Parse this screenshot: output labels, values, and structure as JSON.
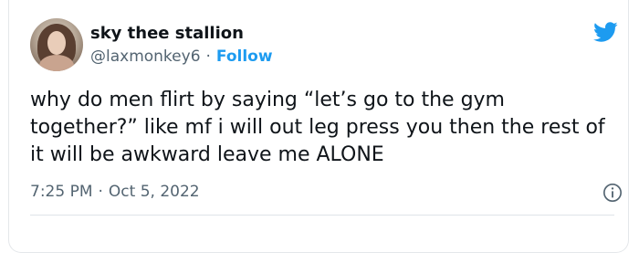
{
  "tweet": {
    "display_name": "sky thee stallion",
    "handle": "@laxmonkey6",
    "separator": "·",
    "follow_label": "Follow",
    "text": "why do men flirt by saying “let’s go to the gym together?” like mf i will out leg press you then the rest of it will be awkward leave me ALONE",
    "time": "7:25 PM",
    "date": "Oct 5, 2022"
  },
  "icons": {
    "brand": "twitter-bird-icon",
    "info": "info-icon",
    "avatar": "avatar"
  },
  "colors": {
    "accent": "#1d9bf0",
    "text": "#0f1419",
    "secondary": "#536471",
    "border": "#e4e7ea"
  }
}
